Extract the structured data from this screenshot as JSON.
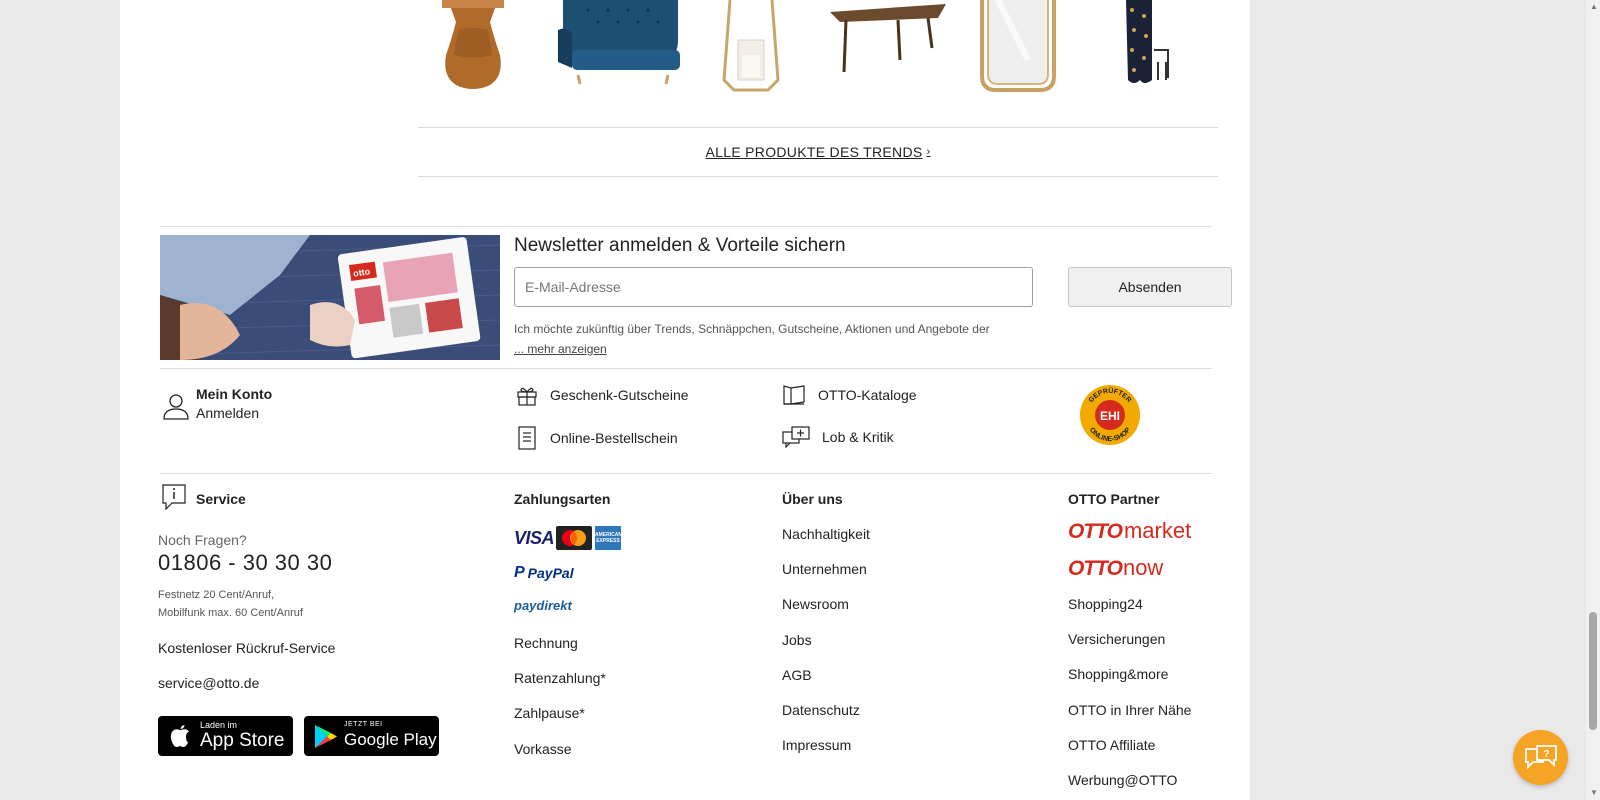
{
  "trend": {
    "all_products_label": "ALLE PRODUKTE DES TRENDS",
    "products": [
      {
        "name": "round-side-table"
      },
      {
        "name": "blue-velvet-sofa"
      },
      {
        "name": "brass-lantern"
      },
      {
        "name": "wooden-coffee-table"
      },
      {
        "name": "gold-mirror"
      },
      {
        "name": "patterned-curtain"
      }
    ]
  },
  "newsletter": {
    "title": "Newsletter anmelden & Vorteile sichern",
    "email_placeholder": "E-Mail-Adresse",
    "submit_label": "Absenden",
    "legal_text": "Ich möchte zukünftig über Trends, Schnäppchen, Gutscheine, Aktionen und Angebote der",
    "more_label": "... mehr anzeigen",
    "image_brand": "otto"
  },
  "account": {
    "title": "Mein Konto",
    "login_label": "Anmelden"
  },
  "quick_links": {
    "gift": "Geschenk-Gutscheine",
    "order_form": "Online-Bestellschein",
    "catalogs": "OTTO-Kataloge",
    "feedback": "Lob & Kritik"
  },
  "ehi": {
    "center": "EHI",
    "ring_top": "GEPRÜFTER",
    "ring_bottom": "ONLINE-SHOP"
  },
  "service": {
    "title": "Service",
    "question": "Noch Fragen?",
    "phone": "01806 - 30 30 30",
    "fee_line1": "Festnetz 20 Cent/Anruf,",
    "fee_line2": "Mobilfunk max. 60 Cent/Anruf",
    "callback": "Kostenloser Rückruf-Service",
    "email": "service@otto.de",
    "appstore_small": "Laden im",
    "appstore_big": "App Store",
    "googleplay_small": "JETZT BEI",
    "googleplay_big": "Google Play"
  },
  "payment": {
    "title": "Zahlungsarten",
    "visa": "VISA",
    "amex": "AMERICAN EXPRESS",
    "paypal": "PayPal",
    "paydirekt": "paydirekt",
    "links": [
      "Rechnung",
      "Ratenzahlung*",
      "Zahlpause*",
      "Vorkasse"
    ]
  },
  "about": {
    "title": "Über uns",
    "links": [
      "Nachhaltigkeit",
      "Unternehmen",
      "Newsroom",
      "Jobs",
      "AGB",
      "Datenschutz",
      "Impressum"
    ]
  },
  "partner": {
    "title": "OTTO Partner",
    "market_logo_a": "OTTO",
    "market_logo_b": "market",
    "now_logo_a": "OTTO",
    "now_logo_b": "now",
    "links": [
      "Shopping24",
      "Versicherungen",
      "Shopping&more",
      "OTTO in Ihrer Nähe",
      "OTTO Affiliate",
      "Werbung@OTTO"
    ]
  },
  "colors": {
    "otto_red": "#d52b1e",
    "chat_orange": "#f5a425",
    "ehi_gold": "#f2a900"
  }
}
